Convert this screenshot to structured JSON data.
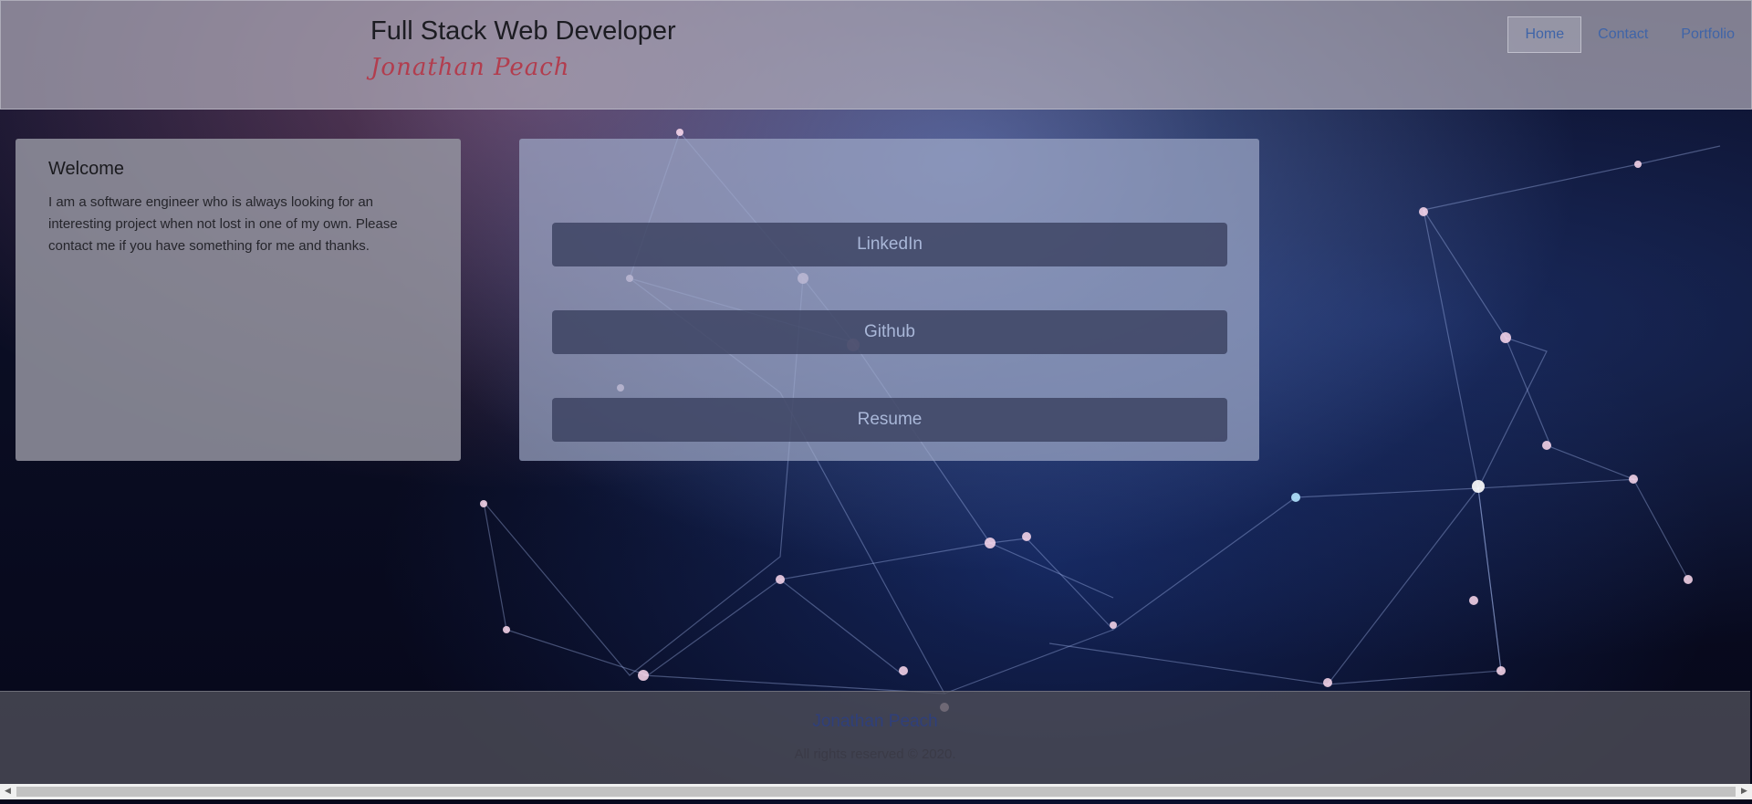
{
  "header": {
    "title": "Full Stack Web Developer",
    "name": "Jonathan Peach"
  },
  "nav": {
    "items": [
      {
        "label": "Home",
        "active": true
      },
      {
        "label": "Contact",
        "active": false
      },
      {
        "label": "Portfolio",
        "active": false
      }
    ]
  },
  "welcome": {
    "title": "Welcome",
    "text": "I am a software engineer who is always looking for an interesting project when not lost in one of my own. Please contact me if you have something for me and thanks."
  },
  "links": {
    "buttons": [
      {
        "label": "LinkedIn"
      },
      {
        "label": "Github"
      },
      {
        "label": "Resume"
      }
    ]
  },
  "footer": {
    "name": "Jonathan Peach",
    "copyright": "All rights reserved © 2020."
  },
  "scrollbar": {
    "left_arrow": "◀",
    "right_arrow": "▶"
  },
  "colors": {
    "name_accent": "#b23d4e",
    "nav_link": "#3f64a8",
    "button_text": "#a9b7d8"
  }
}
